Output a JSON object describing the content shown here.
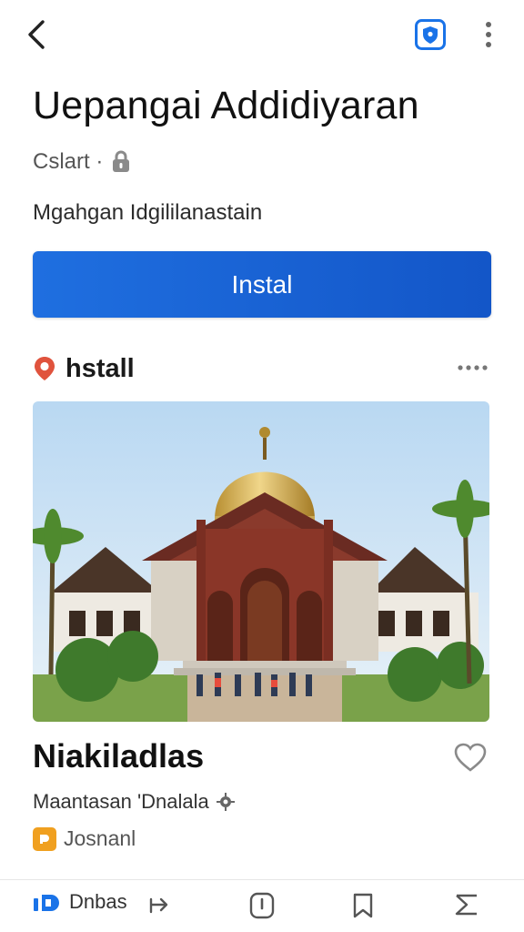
{
  "header": {
    "back_icon": "chevron-left-icon",
    "shield_icon": "shield-icon",
    "more_icon": "more-vertical-icon"
  },
  "app": {
    "title": "Uepangai Addidiyaran",
    "category": "Cslart ·",
    "category_icon": "lock-icon",
    "description": "Mgahgan Idgililanastain",
    "install_label": "Instal",
    "accent": "#1a63d6"
  },
  "section": {
    "icon": "location-pin-icon",
    "label": "hstall",
    "more_icon": "more-horizontal-icon"
  },
  "item": {
    "title": "Niakiladlas",
    "subtitle": "Maantasan 'Dnalala",
    "subtitle_icon": "gear-icon",
    "developer": "Josnanl",
    "developer_icon": "app-icon",
    "favorite_icon": "heart-icon"
  },
  "bottom_nav": {
    "home_label": "Dnbas",
    "home_icon": "home-logo-icon",
    "share_icon": "share-icon",
    "alert_icon": "alert-icon",
    "bookmark_icon": "bookmark-icon",
    "sigma_icon": "sigma-icon"
  }
}
